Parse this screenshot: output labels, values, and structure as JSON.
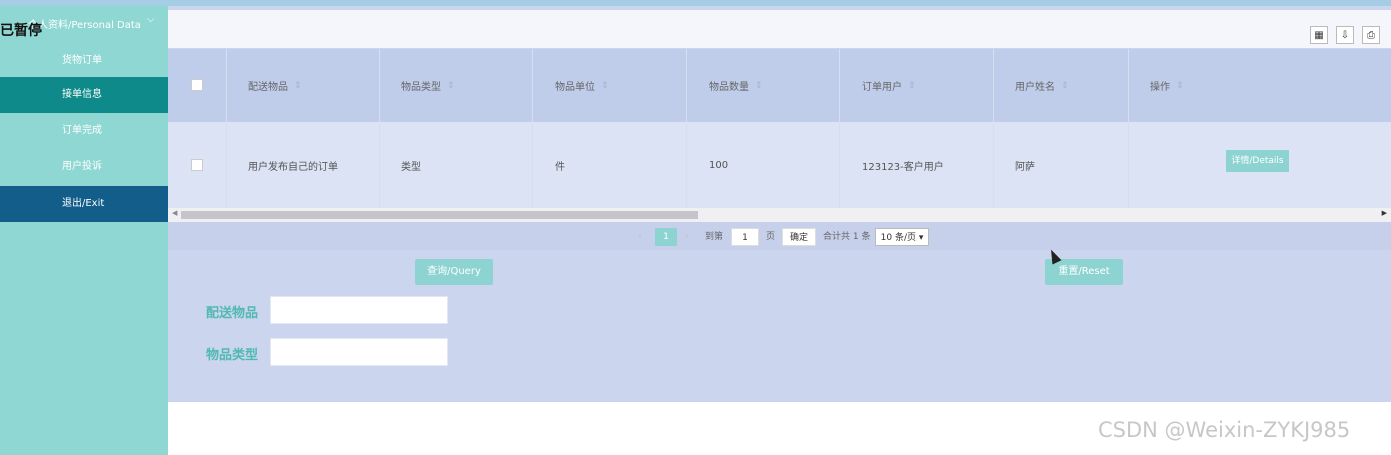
{
  "sidebar": {
    "header": "个人资料/Personal Data",
    "overlay_text": "已暂停",
    "items": [
      {
        "label": "货物订单"
      },
      {
        "label": "接单信息"
      },
      {
        "label": "订单完成"
      },
      {
        "label": "用户投诉"
      },
      {
        "label": "退出/Exit"
      }
    ]
  },
  "table": {
    "headers": [
      "配送物品",
      "物品类型",
      "物品单位",
      "物品数量",
      "订单用户",
      "用户姓名",
      "操作"
    ],
    "rows": [
      {
        "cells": [
          "用户发布自己的订单",
          "类型",
          "件",
          "100",
          "123123-客户用户",
          "阿萨"
        ],
        "action": "详情/Details"
      }
    ]
  },
  "pagination": {
    "current": "1",
    "goto_label": "到第",
    "page_input": "1",
    "page_suffix": "页",
    "confirm": "确定",
    "total": "合计共 1 条",
    "per_page": "10 条/页"
  },
  "search": {
    "query_button": "查询/Query",
    "reset_button": "重置/Reset",
    "fields": [
      {
        "label": "配送物品",
        "value": ""
      },
      {
        "label": "物品类型",
        "value": ""
      }
    ]
  },
  "watermark": "CSDN @Weixin-ZYKJ985",
  "colors": {
    "teal": "#8dd3d2",
    "active": "#0f8a8a",
    "exit": "#135d8a",
    "sidebar": "#8fd7d3"
  }
}
